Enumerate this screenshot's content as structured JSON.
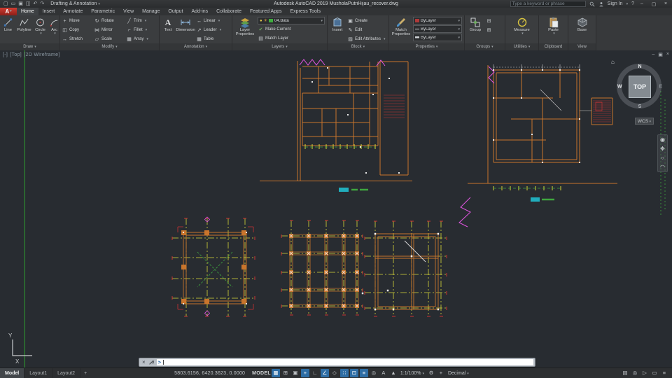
{
  "titlebar": {
    "app_logo": "A",
    "quick_access": [
      {
        "name": "new-file",
        "glyph": "▢"
      },
      {
        "name": "open-file",
        "glyph": "▭"
      },
      {
        "name": "save-file",
        "glyph": "▣"
      },
      {
        "name": "plot",
        "glyph": "◫"
      },
      {
        "name": "undo",
        "glyph": "↶"
      },
      {
        "name": "redo",
        "glyph": "↷"
      }
    ],
    "workspace": "Drafting & Annotation",
    "title": "Autodesk AutoCAD 2019   MusholaPutriHijau_recover.dwg",
    "search_placeholder": "Type a keyword or phrase",
    "sign_in": "Sign In",
    "help_glyph": "?",
    "window_buttons": {
      "minimize": "–",
      "restore": "▢",
      "close": "×"
    }
  },
  "ribbon": {
    "tabs": [
      "Home",
      "Insert",
      "Annotate",
      "Parametric",
      "View",
      "Manage",
      "Output",
      "Add-ins",
      "Collaborate",
      "Featured Apps",
      "Express Tools"
    ],
    "draw": {
      "label": "Draw",
      "items": [
        "Line",
        "Polyline",
        "Circle",
        "Arc"
      ]
    },
    "modify": {
      "label": "Modify",
      "items": [
        "Move",
        "Copy",
        "Stretch",
        "Rotate",
        "Mirror",
        "Scale",
        "Trim",
        "Fillet",
        "Array"
      ],
      "icons": [
        "+",
        "◫",
        "↔",
        "↻",
        "⋈",
        "▱",
        "╱",
        "⌐",
        "▦"
      ]
    },
    "annotation": {
      "label": "Annotation",
      "big": [
        "Text",
        "Dimension"
      ],
      "items": [
        "Linear",
        "Leader",
        "Table"
      ],
      "icons": [
        "↔",
        "↗",
        "▦"
      ]
    },
    "layers": {
      "label": "Layers",
      "big": "Layer Properties",
      "current_layer": "04.Bata",
      "items": [
        "Make Current",
        "Match Layer"
      ],
      "icons": [
        "✔",
        "▤"
      ]
    },
    "block": {
      "label": "Block",
      "big": "Insert",
      "items": [
        "Create",
        "Edit",
        "Edit Attributes"
      ],
      "icons": [
        "▣",
        "✎",
        "▨"
      ]
    },
    "properties": {
      "label": "Properties",
      "big": "Match Properties",
      "combos": [
        "ByLayer",
        "ByLayer",
        "ByLayer"
      ]
    },
    "groups": {
      "label": "Groups",
      "big": "Group"
    },
    "utilities": {
      "label": "Utilities",
      "big": "Measure"
    },
    "clipboard": {
      "label": "Clipboard",
      "big": "Paste"
    },
    "view": {
      "label": "View",
      "big": "Base"
    }
  },
  "viewport": {
    "vp_controls": [
      "[-]",
      "[Top]",
      "[2D Wireframe]"
    ],
    "window_buttons": {
      "minimize": "–",
      "restore": "▣",
      "close": "×"
    },
    "viewcube": {
      "top": "TOP",
      "n": "N",
      "s": "S",
      "e": "E",
      "w": "W",
      "wcs": "WCS",
      "home": "⌂"
    },
    "ucs": {
      "x": "X",
      "y": "Y"
    }
  },
  "command": {
    "close_glyph": "×",
    "prompt": ">"
  },
  "statusbar": {
    "layout_tabs": [
      "Model",
      "Layout1",
      "Layout2"
    ],
    "new_layout_glyph": "+",
    "coords": "5803.6156, 6420.3623, 0.0000",
    "model_label": "MODEL",
    "toggles": [
      {
        "name": "grid-mode",
        "glyph": "▦",
        "active": true
      },
      {
        "name": "snap-mode",
        "glyph": "⊞",
        "active": false
      },
      {
        "name": "infer-constraints",
        "glyph": "▣",
        "active": false
      },
      {
        "name": "dynamic-input",
        "glyph": "+",
        "active": true
      },
      {
        "name": "ortho-mode",
        "glyph": "∟",
        "active": false
      },
      {
        "name": "polar-tracking",
        "glyph": "∠",
        "active": true
      },
      {
        "name": "isometric-drafting",
        "glyph": "◇",
        "active": false
      },
      {
        "name": "object-snap-tracking",
        "glyph": "∷",
        "active": true
      },
      {
        "name": "object-snap",
        "glyph": "⊡",
        "active": true
      },
      {
        "name": "lineweight",
        "glyph": "≡",
        "active": true
      },
      {
        "name": "selection-cycling",
        "glyph": "◎",
        "active": false
      }
    ],
    "annotation_tools": [
      {
        "name": "annotation-visibility",
        "glyph": "A"
      },
      {
        "name": "autoscale",
        "glyph": "▲"
      }
    ],
    "annotation_scale": "1:1/100%",
    "units": "Decimal",
    "right_tools": [
      {
        "name": "workspace-switching",
        "glyph": "⚙"
      },
      {
        "name": "annotation-monitor",
        "glyph": "+"
      },
      {
        "name": "quick-properties",
        "glyph": "▤"
      },
      {
        "name": "isolate-objects",
        "glyph": "◎"
      },
      {
        "name": "graphics-performance",
        "glyph": "▷"
      },
      {
        "name": "clean-screen",
        "glyph": "▭"
      },
      {
        "name": "customization",
        "glyph": "≡"
      }
    ]
  },
  "colors": {
    "status_active": "#2e6da4",
    "cad_orange": "#c9752c",
    "cad_yellow": "#d9d938",
    "cad_red": "#cc3333",
    "cad_magenta": "#e255e2",
    "cad_green": "#3fa63f",
    "cad_cyan": "#21aebd"
  }
}
